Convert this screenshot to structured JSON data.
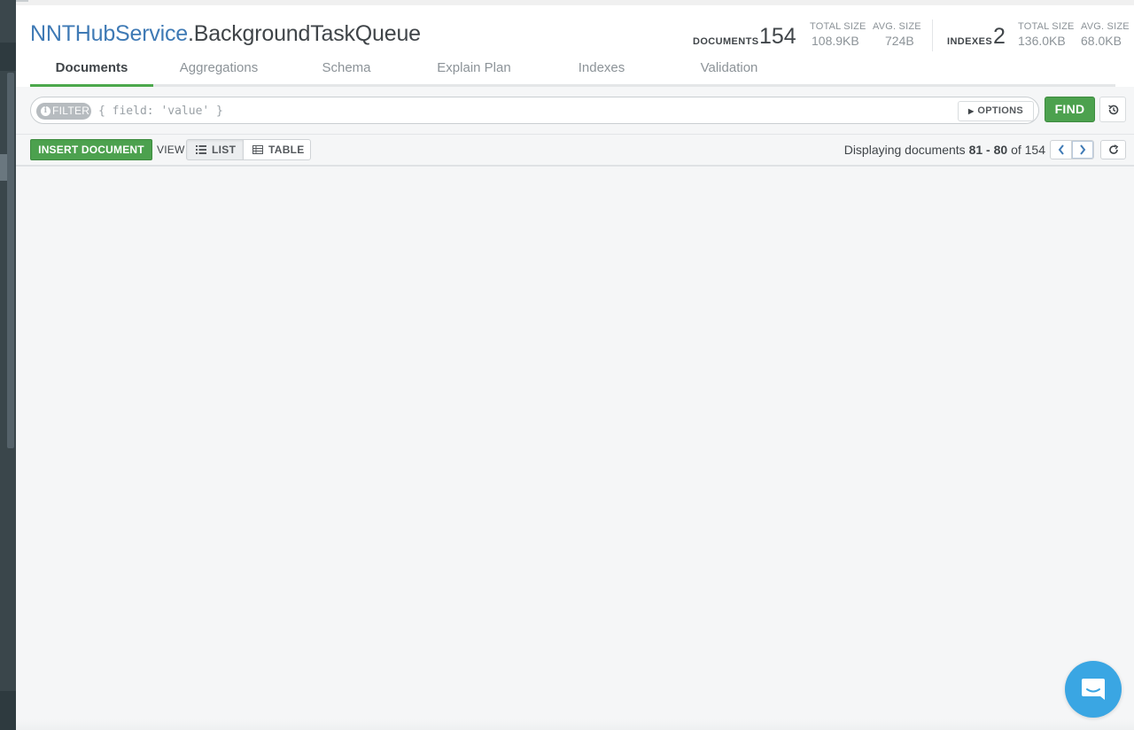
{
  "header": {
    "database": "NNTHubService",
    "dot": ".",
    "collection": "BackgroundTaskQueue"
  },
  "stats": {
    "documents_label": "DOCUMENTS",
    "documents_count": "154",
    "doc_total_size_label": "TOTAL SIZE",
    "doc_total_size": "108.9KB",
    "doc_avg_size_label": "AVG. SIZE",
    "doc_avg_size": "724B",
    "indexes_label": "INDEXES",
    "indexes_count": "2",
    "idx_total_size_label": "TOTAL SIZE",
    "idx_total_size": "136.0KB",
    "idx_avg_size_label": "AVG. SIZE",
    "idx_avg_size": "68.0KB"
  },
  "tabs": [
    {
      "label": "Documents",
      "active": true
    },
    {
      "label": "Aggregations",
      "active": false
    },
    {
      "label": "Schema",
      "active": false
    },
    {
      "label": "Explain Plan",
      "active": false
    },
    {
      "label": "Indexes",
      "active": false
    },
    {
      "label": "Validation",
      "active": false
    }
  ],
  "filter": {
    "pill_label": "FILTER",
    "placeholder": "{ field: 'value' }",
    "value": "",
    "options_label": "OPTIONS",
    "find_label": "FIND"
  },
  "toolbar": {
    "insert_label": "INSERT DOCUMENT",
    "view_label": "VIEW",
    "list_label": "LIST",
    "table_label": "TABLE",
    "active_view": "LIST"
  },
  "pagination": {
    "prefix": "Displaying documents",
    "range_start": "81",
    "range_sep": "-",
    "range_end": "80",
    "of_label": "of",
    "total": "154"
  },
  "colors": {
    "accent_green": "#4ca14e",
    "db_blue": "#3f7ab5",
    "chat_blue": "#3aa6e3"
  },
  "icons": [
    "info-icon",
    "caret-right-icon",
    "history-icon",
    "list-icon",
    "table-icon",
    "chevron-left-icon",
    "chevron-right-icon",
    "refresh-icon",
    "chat-icon"
  ]
}
